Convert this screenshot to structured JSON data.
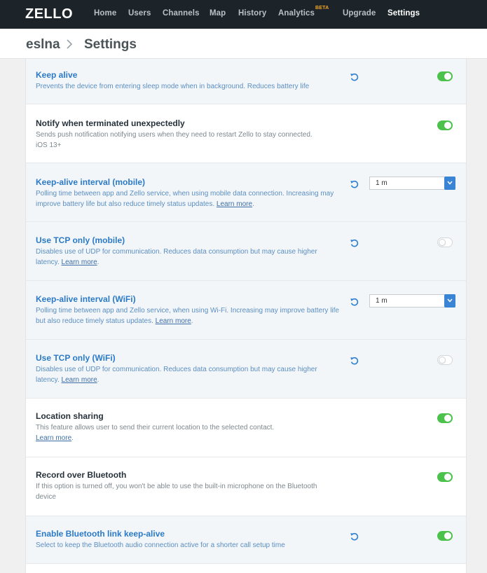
{
  "nav": {
    "logo": "ZELLO",
    "items": [
      "Home",
      "Users",
      "Channels",
      "Map",
      "History",
      "Analytics",
      "Upgrade",
      "Settings"
    ],
    "active": "Settings",
    "beta_badge": "BETA"
  },
  "breadcrumb": {
    "parent": "eslna",
    "current": "Settings"
  },
  "settings": [
    {
      "title": "Keep alive",
      "desc": "Prevents the device from entering sleep mode when in background. Reduces battery life",
      "control": "toggle",
      "on": true,
      "reset": true
    },
    {
      "title": "Notify when terminated unexpectedly",
      "desc": "Sends push notification notifying users when they need to restart Zello to stay connected. iOS 13+",
      "control": "toggle",
      "on": true,
      "reset": false
    },
    {
      "title": "Keep-alive interval (mobile)",
      "desc": "Polling time between app and Zello service, when using mobile data connection. Increasing may improve battery life but also reduce timely status updates.",
      "link": "Learn more",
      "control": "select",
      "value": "1 m",
      "reset": true
    },
    {
      "title": "Use TCP only (mobile)",
      "desc": "Disables use of UDP for communication. Reduces data consumption but may cause higher latency.",
      "link": "Learn more",
      "control": "toggle",
      "on": false,
      "reset": true
    },
    {
      "title": "Keep-alive interval (WiFi)",
      "desc": "Polling time between app and Zello service, when using Wi-Fi. Increasing may improve battery life but also reduce timely status updates.",
      "link": "Learn more",
      "control": "select",
      "value": "1 m",
      "reset": true
    },
    {
      "title": "Use TCP only (WiFi)",
      "desc": "Disables use of UDP for communication. Reduces data consumption but may cause higher latency.",
      "link": "Learn more",
      "control": "toggle",
      "on": false,
      "reset": true
    },
    {
      "title": "Location sharing",
      "desc": "This feature allows user to send their current location to the selected contact.",
      "link": "Learn more",
      "control": "toggle",
      "on": true,
      "reset": false
    },
    {
      "title": "Record over Bluetooth",
      "desc": "If this option is turned off, you won't be able to use the built-in microphone on the Bluetooth device",
      "control": "toggle",
      "on": true,
      "reset": false
    },
    {
      "title": "Enable Bluetooth link keep-alive",
      "desc": "Select to keep the Bluetooth audio connection active for a shorter call setup time",
      "control": "toggle",
      "on": true,
      "reset": true
    }
  ],
  "colors": {
    "topbar": "#1c2429",
    "accent_blue": "#2a7ac8",
    "toggle_on": "#4cc24c",
    "beta": "#f5a623"
  },
  "icons": {
    "reset": "reset-icon",
    "chevron": "chevron-right-icon",
    "select_arrow": "chevron-down-icon"
  }
}
